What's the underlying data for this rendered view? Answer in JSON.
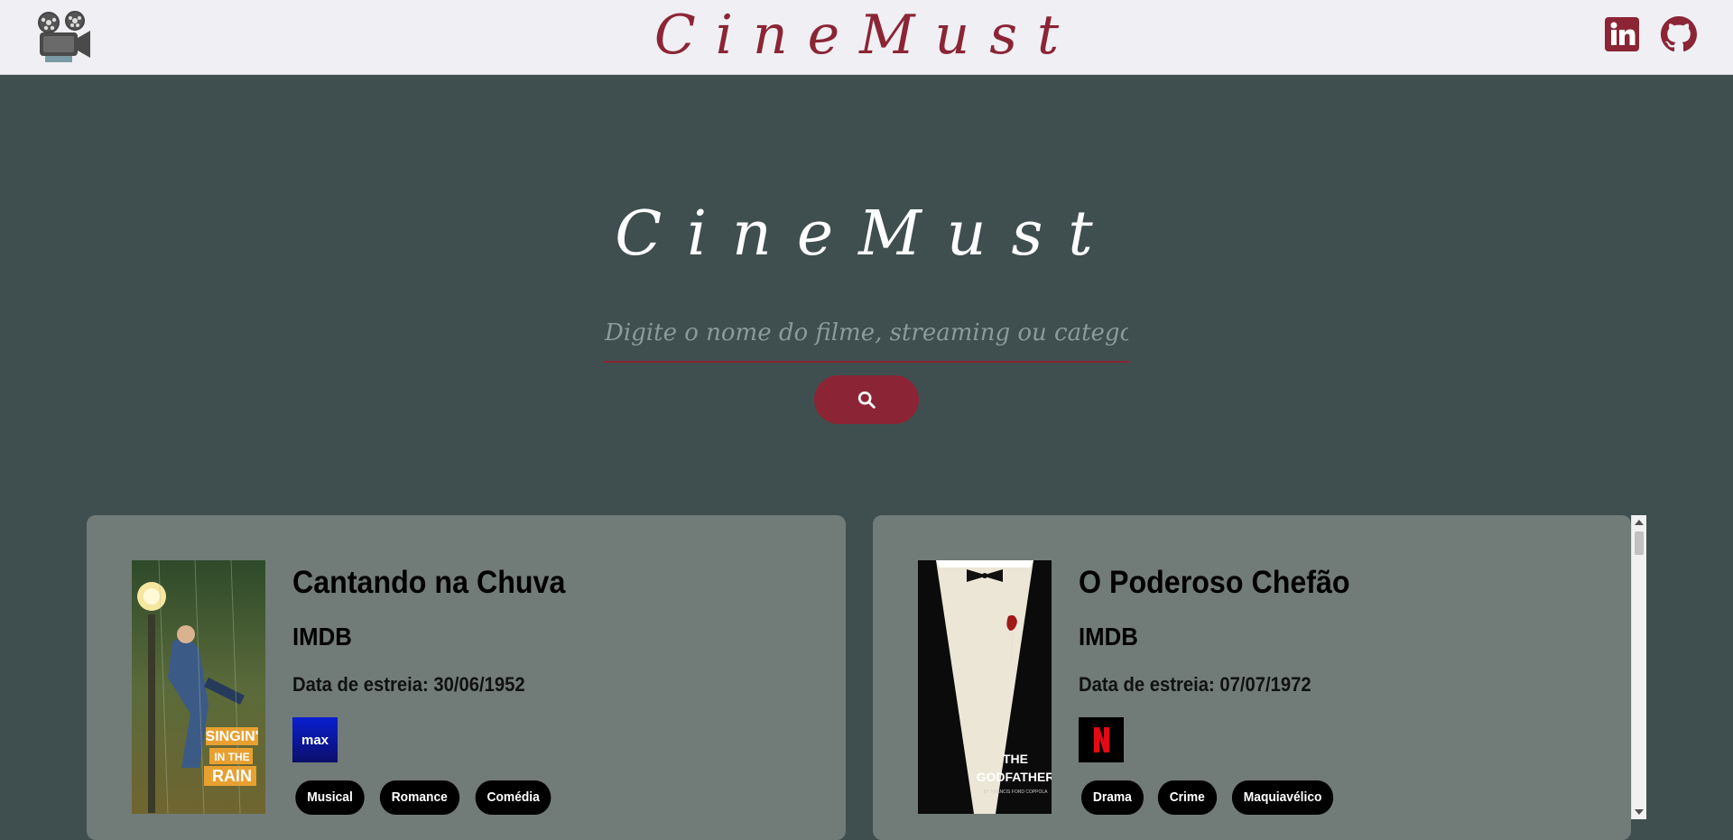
{
  "header": {
    "logo_icon": "movie-projector-icon",
    "title": "CineMust",
    "social": [
      {
        "name": "linkedin-icon",
        "color": "#8b2535"
      },
      {
        "name": "github-icon",
        "color": "#8b2535"
      }
    ]
  },
  "hero": {
    "title": "CineMust",
    "search_placeholder": "Digite o nome do filme, streaming ou categoria",
    "search_icon": "search-icon"
  },
  "movies": [
    {
      "title": "Cantando na Chuva",
      "rating_label": "IMDB",
      "release_label": "Data de estreia:",
      "release_date": "30/06/1952",
      "streaming": "max",
      "poster_text": "SINGIN' IN THE RAIN",
      "tags": [
        "Musical",
        "Romance",
        "Comédia"
      ]
    },
    {
      "title": "O Poderoso Chefão",
      "rating_label": "IMDB",
      "release_label": "Data de estreia:",
      "release_date": "07/07/1972",
      "streaming": "N",
      "poster_text": "THE GODFATHER",
      "tags": [
        "Drama",
        "Crime",
        "Maquiavélico"
      ]
    }
  ],
  "colors": {
    "accent": "#8b2535",
    "background": "#3f4f4f",
    "card": "#717b78",
    "topbar": "#efeff4"
  }
}
